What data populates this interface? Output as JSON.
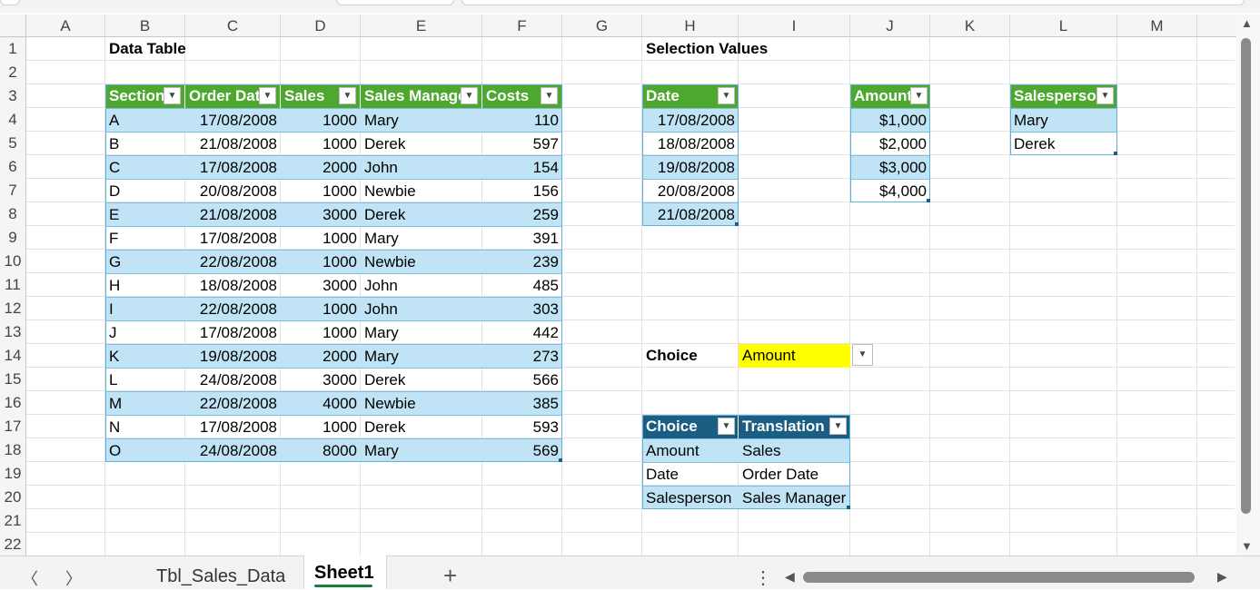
{
  "columns": [
    "A",
    "B",
    "C",
    "D",
    "E",
    "F",
    "G",
    "H",
    "I",
    "J",
    "K",
    "L",
    "M"
  ],
  "rows": [
    "1",
    "2",
    "3",
    "4",
    "5",
    "6",
    "7",
    "8",
    "9",
    "10",
    "11",
    "12",
    "13",
    "14",
    "15",
    "16",
    "17",
    "18",
    "19",
    "20",
    "21",
    "22"
  ],
  "titles": {
    "data_table": "Data Table",
    "selection_values": "Selection Values",
    "choice": "Choice"
  },
  "data_table": {
    "headers": [
      "Section",
      "Order Date",
      "Sales",
      "Sales Manager",
      "Costs"
    ],
    "rows": [
      [
        "A",
        "17/08/2008",
        "1000",
        "Mary",
        "110"
      ],
      [
        "B",
        "21/08/2008",
        "1000",
        "Derek",
        "597"
      ],
      [
        "C",
        "17/08/2008",
        "2000",
        "John",
        "154"
      ],
      [
        "D",
        "20/08/2008",
        "1000",
        "Newbie",
        "156"
      ],
      [
        "E",
        "21/08/2008",
        "3000",
        "Derek",
        "259"
      ],
      [
        "F",
        "17/08/2008",
        "1000",
        "Mary",
        "391"
      ],
      [
        "G",
        "22/08/2008",
        "1000",
        "Newbie",
        "239"
      ],
      [
        "H",
        "18/08/2008",
        "3000",
        "John",
        "485"
      ],
      [
        "I",
        "22/08/2008",
        "1000",
        "John",
        "303"
      ],
      [
        "J",
        "17/08/2008",
        "1000",
        "Mary",
        "442"
      ],
      [
        "K",
        "19/08/2008",
        "2000",
        "Mary",
        "273"
      ],
      [
        "L",
        "24/08/2008",
        "3000",
        "Derek",
        "566"
      ],
      [
        "M",
        "22/08/2008",
        "4000",
        "Newbie",
        "385"
      ],
      [
        "N",
        "17/08/2008",
        "1000",
        "Derek",
        "593"
      ],
      [
        "O",
        "24/08/2008",
        "8000",
        "Mary",
        "569"
      ]
    ]
  },
  "date_table": {
    "header": "Date",
    "values": [
      "17/08/2008",
      "18/08/2008",
      "19/08/2008",
      "20/08/2008",
      "21/08/2008"
    ]
  },
  "amount_table": {
    "header": "Amount",
    "values": [
      "$1,000",
      "$2,000",
      "$3,000",
      "$4,000"
    ]
  },
  "salesperson_table": {
    "header": "Salesperson",
    "values": [
      "Mary",
      "Derek"
    ]
  },
  "choice_selector": {
    "label": "Choice",
    "value": "Amount"
  },
  "translation_table": {
    "headers": [
      "Choice",
      "Translation"
    ],
    "rows": [
      [
        "Amount",
        "Sales"
      ],
      [
        "Date",
        "Order Date"
      ],
      [
        "Salesperson",
        "Sales Manager"
      ]
    ]
  },
  "sheet_tabs": [
    "Tbl_Sales_Data",
    "Sheet1"
  ],
  "active_tab": "Sheet1",
  "icons": {
    "prev_sheet": "chevron-left-icon",
    "next_sheet": "chevron-right-icon",
    "add_sheet": "plus-icon",
    "more": "vertical-dots-icon"
  },
  "colors": {
    "table_header_green": "#4ea72e",
    "table_header_blue": "#1b5e83",
    "band_blue": "#c0e4f5",
    "highlight_yellow": "#ffff00"
  }
}
